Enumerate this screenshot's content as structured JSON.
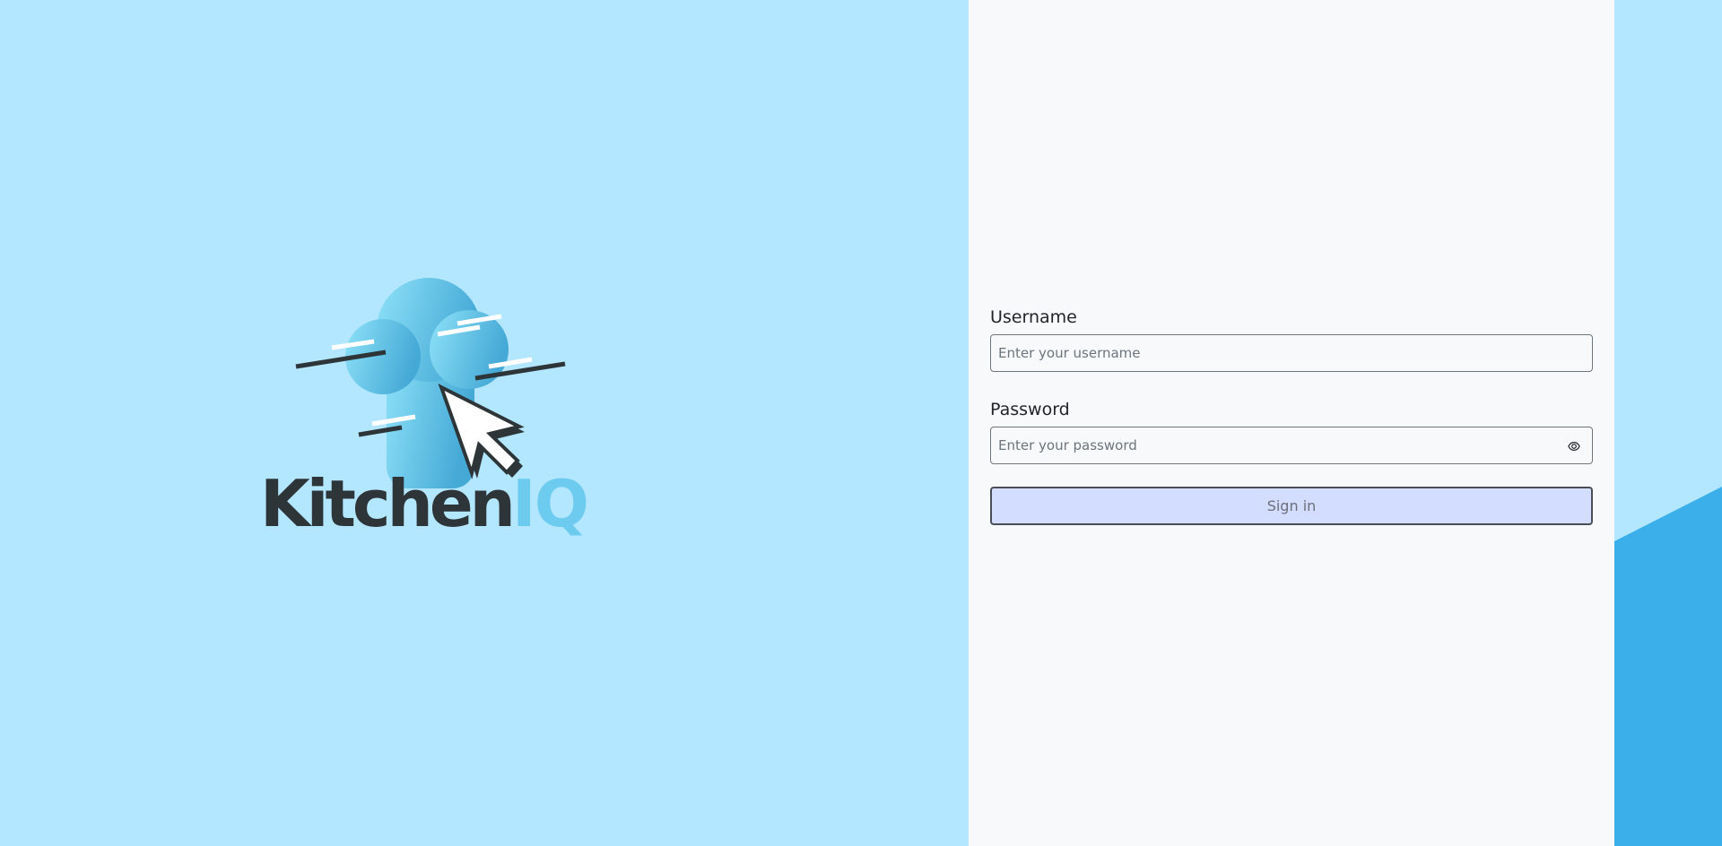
{
  "brand": {
    "logo_text_part1": "Kitchen",
    "logo_text_part2": "IQ",
    "logo_icon": "chef-hat-cursor-icon",
    "colors": {
      "dark": "#2d3538",
      "accent_light": "#7dd8f5",
      "accent_dark": "#4aaed6",
      "background": "#b3e6ff",
      "panel": "#f8f9fa",
      "corner_accent": "#3aafea"
    }
  },
  "login_form": {
    "username": {
      "label": "Username",
      "placeholder": "Enter your username",
      "value": ""
    },
    "password": {
      "label": "Password",
      "placeholder": "Enter your password",
      "value": "",
      "toggle_icon": "eye-icon"
    },
    "submit_label": "Sign in",
    "submit_color": "#d3ddff"
  }
}
